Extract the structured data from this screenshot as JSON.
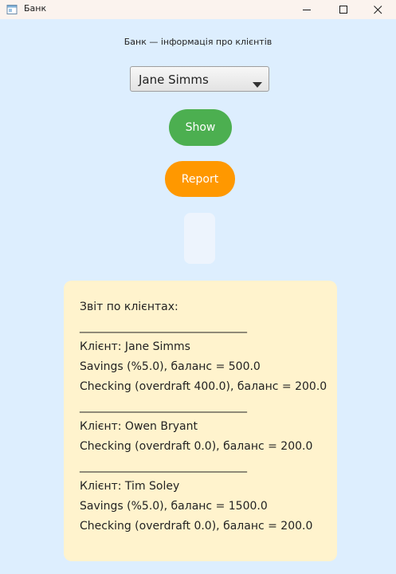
{
  "window": {
    "title": "Банк"
  },
  "header": {
    "label": "Банк — інформація про клієнтів"
  },
  "client_select": {
    "selected": "Jane Simms"
  },
  "buttons": {
    "show": "Show",
    "report": "Report"
  },
  "colors": {
    "background": "#ddeefe",
    "show_button": "#4caf50",
    "report_button": "#ff9800",
    "report_panel": "#fff3cd"
  },
  "icons": {
    "app": "app-window-icon",
    "minimize": "minimize-icon",
    "maximize": "maximize-icon",
    "close": "close-icon",
    "dropdown": "chevron-down-icon"
  },
  "report": {
    "lines": [
      "Звіт по клієнтах:",
      "______________________________",
      "Клієнт: Jane Simms",
      "Savings (%5.0), баланс = 500.0",
      "Checking (overdraft 400.0), баланс = 200.0",
      "______________________________",
      "Клієнт: Owen Bryant",
      "Checking (overdraft 0.0), баланс = 200.0",
      "______________________________",
      "Клієнт: Tim Soley",
      "Savings (%5.0), баланс = 1500.0",
      "Checking (overdraft 0.0), баланс = 200.0"
    ]
  }
}
